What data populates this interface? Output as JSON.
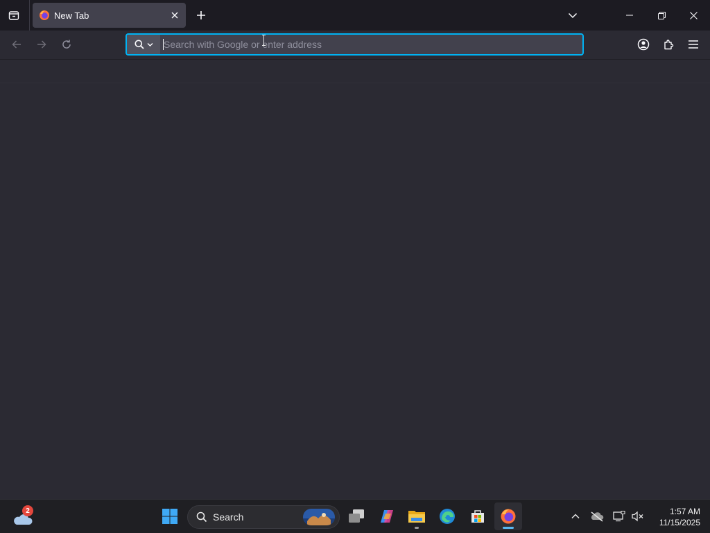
{
  "browser": {
    "tab": {
      "title": "New Tab"
    },
    "urlbar": {
      "placeholder": "Search with Google or enter address",
      "value": ""
    }
  },
  "taskbar": {
    "search_label": "Search",
    "weather_badge": "2",
    "clock": {
      "time": "1:57 AM",
      "date": "11/15/2025"
    }
  },
  "colors": {
    "accent_focus": "#00b3f4",
    "toolbar_bg": "#2b2a33",
    "tabstrip_bg": "#1c1b22",
    "taskbar_bg": "#1f1f23"
  },
  "icons": [
    "tab-list-icon",
    "firefox-icon",
    "close-icon",
    "plus-icon",
    "chevron-down-icon",
    "minimize-icon",
    "restore-icon",
    "back-icon",
    "forward-icon",
    "reload-icon",
    "search-icon",
    "account-icon",
    "extensions-icon",
    "hamburger-menu-icon",
    "weather-icon",
    "windows-start-icon",
    "task-view-icon",
    "copilot-icon",
    "file-explorer-icon",
    "edge-icon",
    "store-icon",
    "chevron-up-icon",
    "onedrive-icon",
    "display-icon",
    "volume-muted-icon"
  ]
}
